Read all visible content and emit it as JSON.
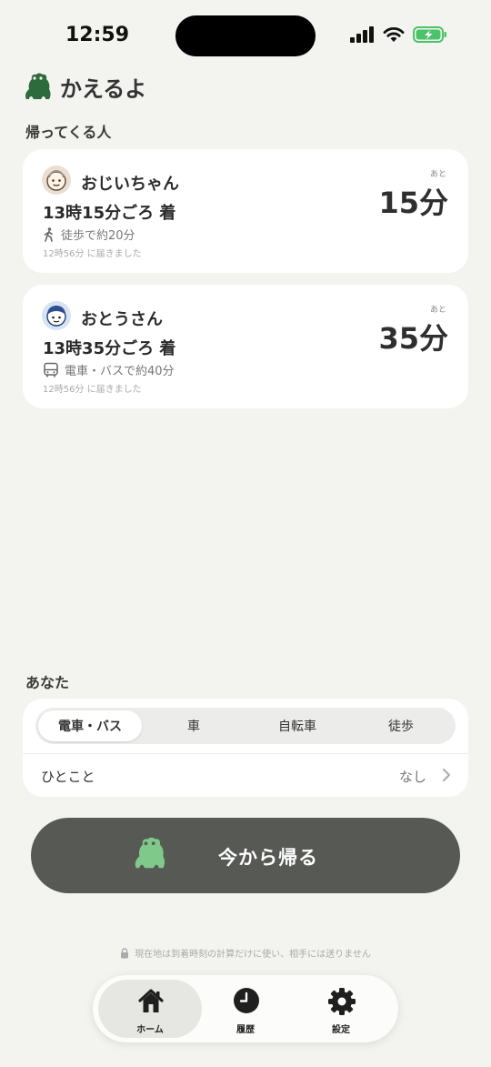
{
  "status_bar": {
    "time": "12:59"
  },
  "app": {
    "title": "かえるよ"
  },
  "returning": {
    "section_title": "帰ってくる人",
    "people": [
      {
        "name": "おじいちゃん",
        "arrival": "13時15分ごろ 着",
        "mode_icon": "walk-icon",
        "mode_text": "徒歩で約20分",
        "received": "12時56分 に届きました",
        "remain_label": "あと",
        "remain_value": "15分"
      },
      {
        "name": "おとうさん",
        "arrival": "13時35分ごろ 着",
        "mode_icon": "bus-icon",
        "mode_text": "電車・バスで約40分",
        "received": "12時56分 に届きました",
        "remain_label": "あと",
        "remain_value": "35分"
      }
    ]
  },
  "you": {
    "section_title": "あなた",
    "modes": [
      "電車・バス",
      "車",
      "自転車",
      "徒歩"
    ],
    "selected_mode": "電車・バス",
    "memo_label": "ひとこと",
    "memo_value": "なし"
  },
  "go_home_button": {
    "label": "今から帰る"
  },
  "privacy_note": "現在地は到着時刻の計算だけに使い、相手には送りません",
  "tabs": [
    {
      "label": "ホーム",
      "icon": "home-icon",
      "active": true
    },
    {
      "label": "履歴",
      "icon": "clock-icon",
      "active": false
    },
    {
      "label": "設定",
      "icon": "gear-icon",
      "active": false
    }
  ],
  "colors": {
    "background": "#f3f3ef",
    "brand_green": "#2e6b3c",
    "button_dark": "#575954",
    "frog_light": "#7fc98a"
  }
}
